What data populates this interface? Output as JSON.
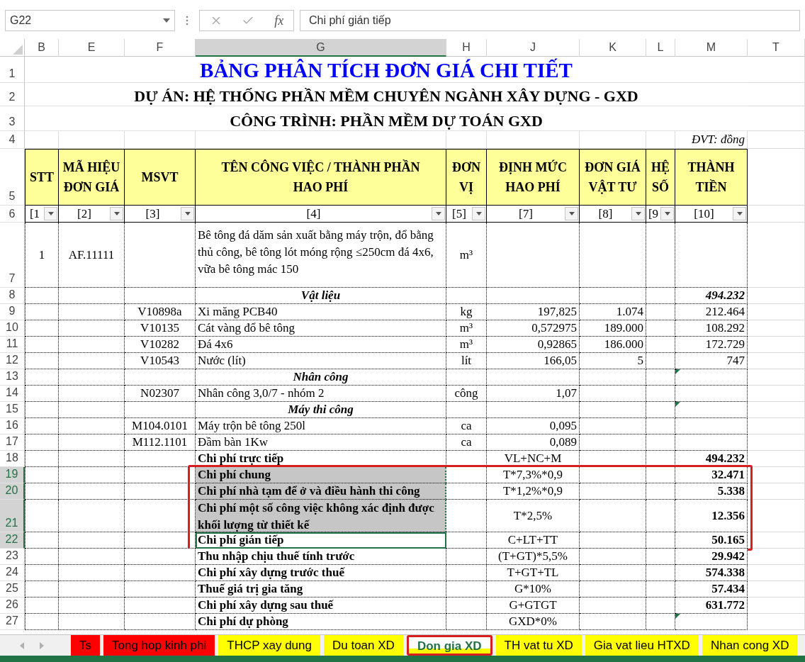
{
  "name_box": "G22",
  "formula_bar": {
    "function_button": "fx",
    "value": "Chi phí gián tiếp"
  },
  "column_headers": [
    {
      "label": "B",
      "selected": false
    },
    {
      "label": "E",
      "selected": false
    },
    {
      "label": "F",
      "selected": false
    },
    {
      "label": "G",
      "selected": true
    },
    {
      "label": "H",
      "selected": false
    },
    {
      "label": "J",
      "selected": false
    },
    {
      "label": "K",
      "selected": false
    },
    {
      "label": "L",
      "selected": false
    },
    {
      "label": "M",
      "selected": false
    },
    {
      "label": "T",
      "selected": false
    }
  ],
  "title_rows": [
    {
      "row": "1",
      "kind": "title",
      "text": "BẢNG PHÂN TÍCH ĐƠN GIÁ CHI TIẾT"
    },
    {
      "row": "2",
      "kind": "subtitle",
      "text": "DỰ ÁN: HỆ THỐNG PHẦN MỀM CHUYÊN NGÀNH XÂY DỰNG - GXD"
    },
    {
      "row": "3",
      "kind": "subtitle",
      "text": "CÔNG TRÌNH: PHẦN MỀM DỰ TOÁN GXD"
    }
  ],
  "note_row": {
    "row": "4",
    "text": "ĐVT: đồng"
  },
  "header_row": {
    "row": "5",
    "labels": [
      "STT",
      "MÃ HIỆU ĐƠN GIÁ",
      "MSVT",
      "TÊN CÔNG VIỆC / THÀNH PHẦN HAO PHÍ",
      "ĐƠN VỊ",
      "ĐỊNH MỨC HAO PHÍ",
      "ĐƠN GIÁ VẬT TƯ",
      "HỆ SỐ",
      "THÀNH TIỀN"
    ]
  },
  "index_row": {
    "row": "6",
    "labels": [
      "[1",
      "[2]",
      "[3]",
      "[4]",
      "[5]",
      "[7]",
      "[8]",
      "[9",
      "[10]"
    ]
  },
  "rows": [
    {
      "row": "7",
      "kind": "item",
      "stt": "1",
      "code": "AF.11111",
      "name": "Bê tông đá dăm sản xuất bằng máy trộn, đổ bằng thủ công, bê tông lót móng rộng ≤250cm đá 4x6, vữa bê tông mác 150",
      "unit": "m³",
      "selected": false,
      "active": false,
      "boxed": false,
      "comment": false
    },
    {
      "row": "8",
      "kind": "group",
      "name": "Vật liệu",
      "amount": "494.232",
      "selected": false,
      "active": false,
      "boxed": false,
      "comment": false
    },
    {
      "row": "9",
      "kind": "item",
      "msvt": "V10898a",
      "name": "Xi măng PCB40",
      "unit": "kg",
      "norm": "197,825",
      "price": "1.074",
      "amount": "212.464",
      "selected": false,
      "active": false,
      "boxed": false,
      "comment": false
    },
    {
      "row": "10",
      "kind": "item",
      "msvt": "V10135",
      "name": "Cát vàng đổ bê tông",
      "unit": "m³",
      "norm": "0,572975",
      "price": "189.000",
      "amount": "108.292",
      "selected": false,
      "active": false,
      "boxed": false,
      "comment": false
    },
    {
      "row": "11",
      "kind": "item",
      "msvt": "V10282",
      "name": "Đá 4x6",
      "unit": "m³",
      "norm": "0,92865",
      "price": "186.000",
      "amount": "172.729",
      "selected": false,
      "active": false,
      "boxed": false,
      "comment": false
    },
    {
      "row": "12",
      "kind": "item",
      "msvt": "V10543",
      "name": "Nước (lít)",
      "unit": "lít",
      "norm": "166,05",
      "price": "5",
      "amount": "747",
      "selected": false,
      "active": false,
      "boxed": false,
      "comment": false
    },
    {
      "row": "13",
      "kind": "group",
      "name": "Nhân công",
      "selected": false,
      "active": false,
      "boxed": false,
      "comment": true
    },
    {
      "row": "14",
      "kind": "item",
      "msvt": "N02307",
      "name": "Nhân công 3,0/7 - nhóm 2",
      "unit": "công",
      "norm": "1,07",
      "selected": false,
      "active": false,
      "boxed": false,
      "comment": false
    },
    {
      "row": "15",
      "kind": "group",
      "name": "Máy thi công",
      "selected": false,
      "active": false,
      "boxed": false,
      "comment": true
    },
    {
      "row": "16",
      "kind": "item",
      "msvt": "M104.0101",
      "name": "Máy trộn bê tông 250l",
      "unit": "ca",
      "norm": "0,095",
      "selected": false,
      "active": false,
      "boxed": false,
      "comment": false
    },
    {
      "row": "17",
      "kind": "item",
      "msvt": "M112.1101",
      "name": "Đầm bàn 1Kw",
      "unit": "ca",
      "norm": "0,089",
      "selected": false,
      "active": false,
      "boxed": false,
      "comment": false
    },
    {
      "row": "18",
      "kind": "total",
      "name": "Chi phí trực tiếp",
      "norm": "VL+NC+M",
      "amount": "494.232",
      "selected": false,
      "active": false,
      "boxed": false,
      "comment": false
    },
    {
      "row": "19",
      "kind": "total",
      "name": "Chi phí chung",
      "norm": "T*7,3%*0,9",
      "amount": "32.471",
      "selected": true,
      "active": false,
      "boxed": true,
      "comment": false
    },
    {
      "row": "20",
      "kind": "total",
      "name": "Chi phí nhà tạm để ở và điều hành thi công",
      "norm": "T*1,2%*0,9",
      "amount": "5.338",
      "selected": true,
      "active": false,
      "boxed": true,
      "comment": false
    },
    {
      "row": "21",
      "kind": "total",
      "name": "Chi phí một số công việc không xác định được khối lượng từ thiết kế",
      "norm": "T*2,5%",
      "amount": "12.356",
      "selected": true,
      "active": false,
      "boxed": true,
      "comment": false
    },
    {
      "row": "22",
      "kind": "total",
      "name": "Chi phí gián tiếp",
      "norm": "C+LT+TT",
      "amount": "50.165",
      "selected": true,
      "active": true,
      "boxed": true,
      "comment": false
    },
    {
      "row": "23",
      "kind": "total",
      "name": "Thu nhập chịu thuế tính trước",
      "norm": "(T+GT)*5,5%",
      "amount": "29.942",
      "selected": false,
      "active": false,
      "boxed": false,
      "comment": false
    },
    {
      "row": "24",
      "kind": "total",
      "name": "Chi phí xây dựng trước thuế",
      "norm": "T+GT+TL",
      "amount": "574.338",
      "selected": false,
      "active": false,
      "boxed": false,
      "comment": false
    },
    {
      "row": "25",
      "kind": "total",
      "name": "Thuế giá trị gia tăng",
      "norm": "G*10%",
      "amount": "57.434",
      "selected": false,
      "active": false,
      "boxed": false,
      "comment": false
    },
    {
      "row": "26",
      "kind": "total",
      "name": "Chi phí xây dựng sau thuế",
      "norm": "G+GTGT",
      "amount": "631.772",
      "selected": false,
      "active": false,
      "boxed": false,
      "comment": false
    },
    {
      "row": "27",
      "kind": "total",
      "name": "Chi phí dự phòng",
      "norm": "GXD*0%",
      "selected": false,
      "active": false,
      "boxed": false,
      "comment": true
    }
  ],
  "sheet_tabs": [
    {
      "label": "Ts",
      "color": "#ff0000",
      "selected": false,
      "highlighted": false
    },
    {
      "label": "Tong hop kinh phi",
      "color": "#ff0000",
      "selected": false,
      "highlighted": false
    },
    {
      "label": "THCP xay dung",
      "color": "#ffff00",
      "selected": false,
      "highlighted": false
    },
    {
      "label": "Du toan XD",
      "color": "#ffff00",
      "selected": false,
      "highlighted": false
    },
    {
      "label": "Don gia XD",
      "color": "#ffff00",
      "selected": true,
      "highlighted": true
    },
    {
      "label": "TH vat tu XD",
      "color": "#ffff00",
      "selected": false,
      "highlighted": false
    },
    {
      "label": "Gia vat lieu HTXD",
      "color": "#ffff00",
      "selected": false,
      "highlighted": false
    },
    {
      "label": "Nhan cong XD",
      "color": "#ffff00",
      "selected": false,
      "highlighted": false
    }
  ]
}
